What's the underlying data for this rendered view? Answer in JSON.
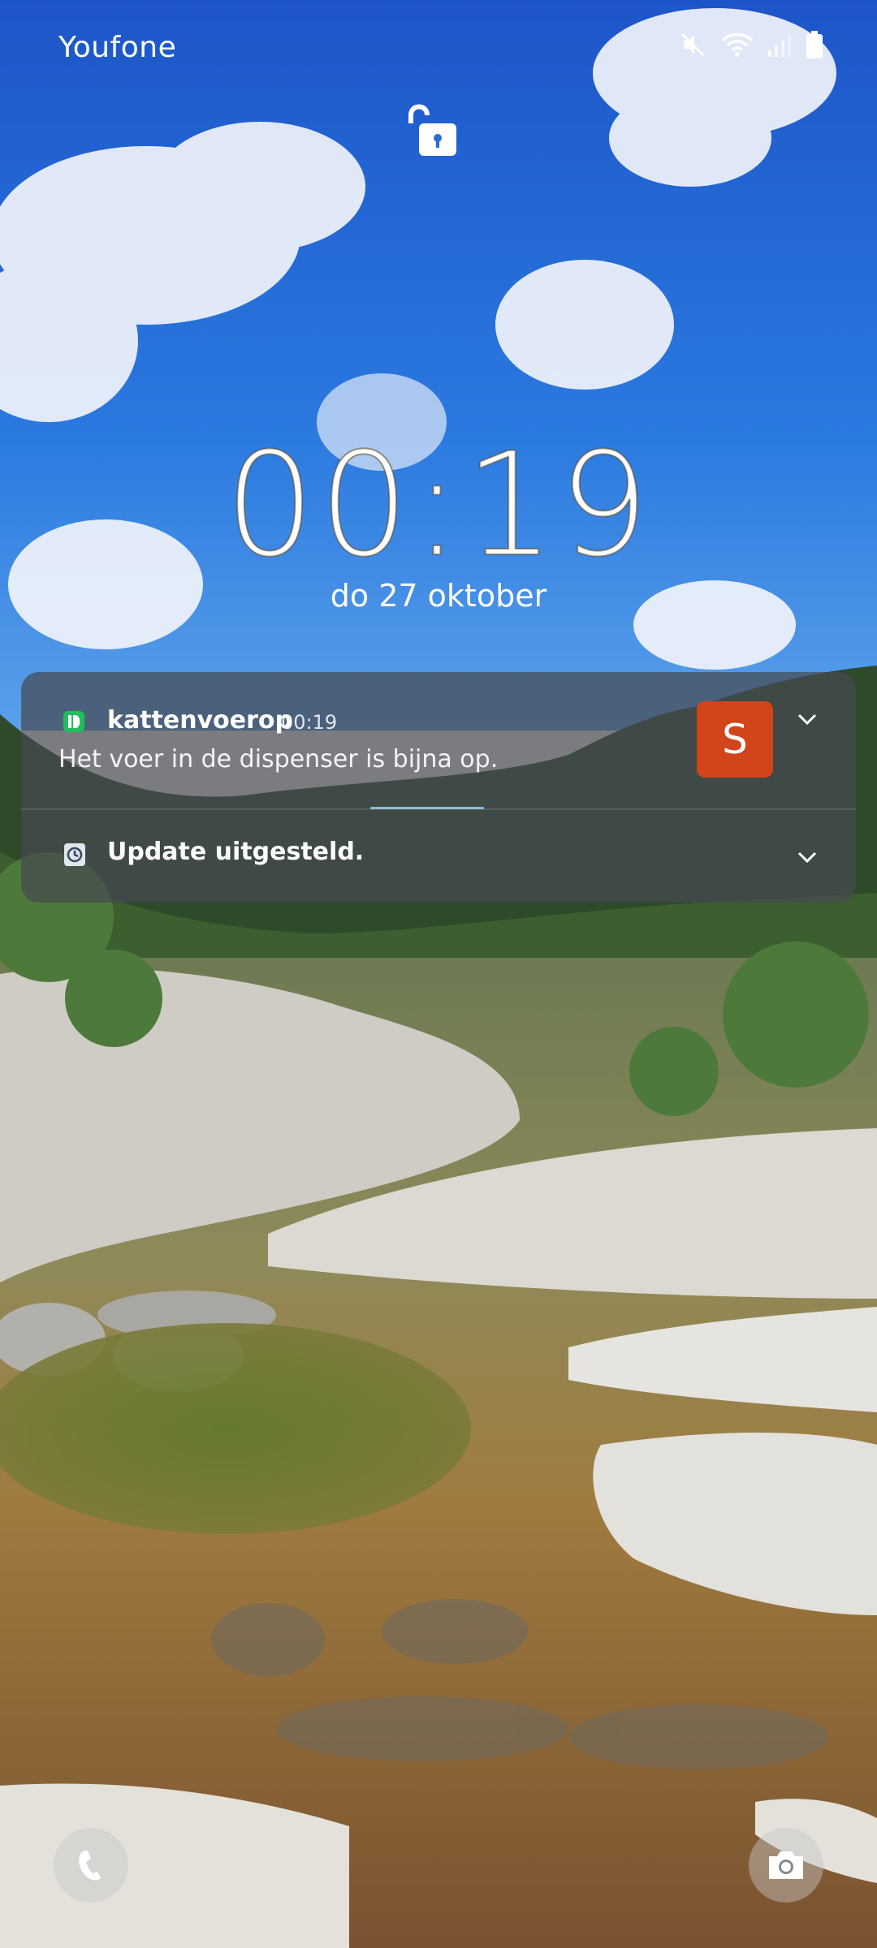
{
  "status_bar": {
    "carrier": "Youfone",
    "icons": [
      "mute-icon",
      "wifi-icon",
      "signal-icon",
      "battery-icon"
    ]
  },
  "lock": {
    "icon": "unlock-icon"
  },
  "clock": {
    "time": "00:19",
    "date": "do 27 oktober"
  },
  "notifications": [
    {
      "app_icon": "kattenvoerop-app-icon",
      "app_name": "kattenvoerop",
      "time": "00:19",
      "body": "Het voer in de dispenser is bijna op.",
      "avatar_letter": "S",
      "avatar_color": "#d2441a"
    },
    {
      "app_icon": "clock-icon",
      "title": "Update uitgesteld."
    }
  ],
  "shortcuts": {
    "left": "phone-icon",
    "right": "camera-icon"
  }
}
